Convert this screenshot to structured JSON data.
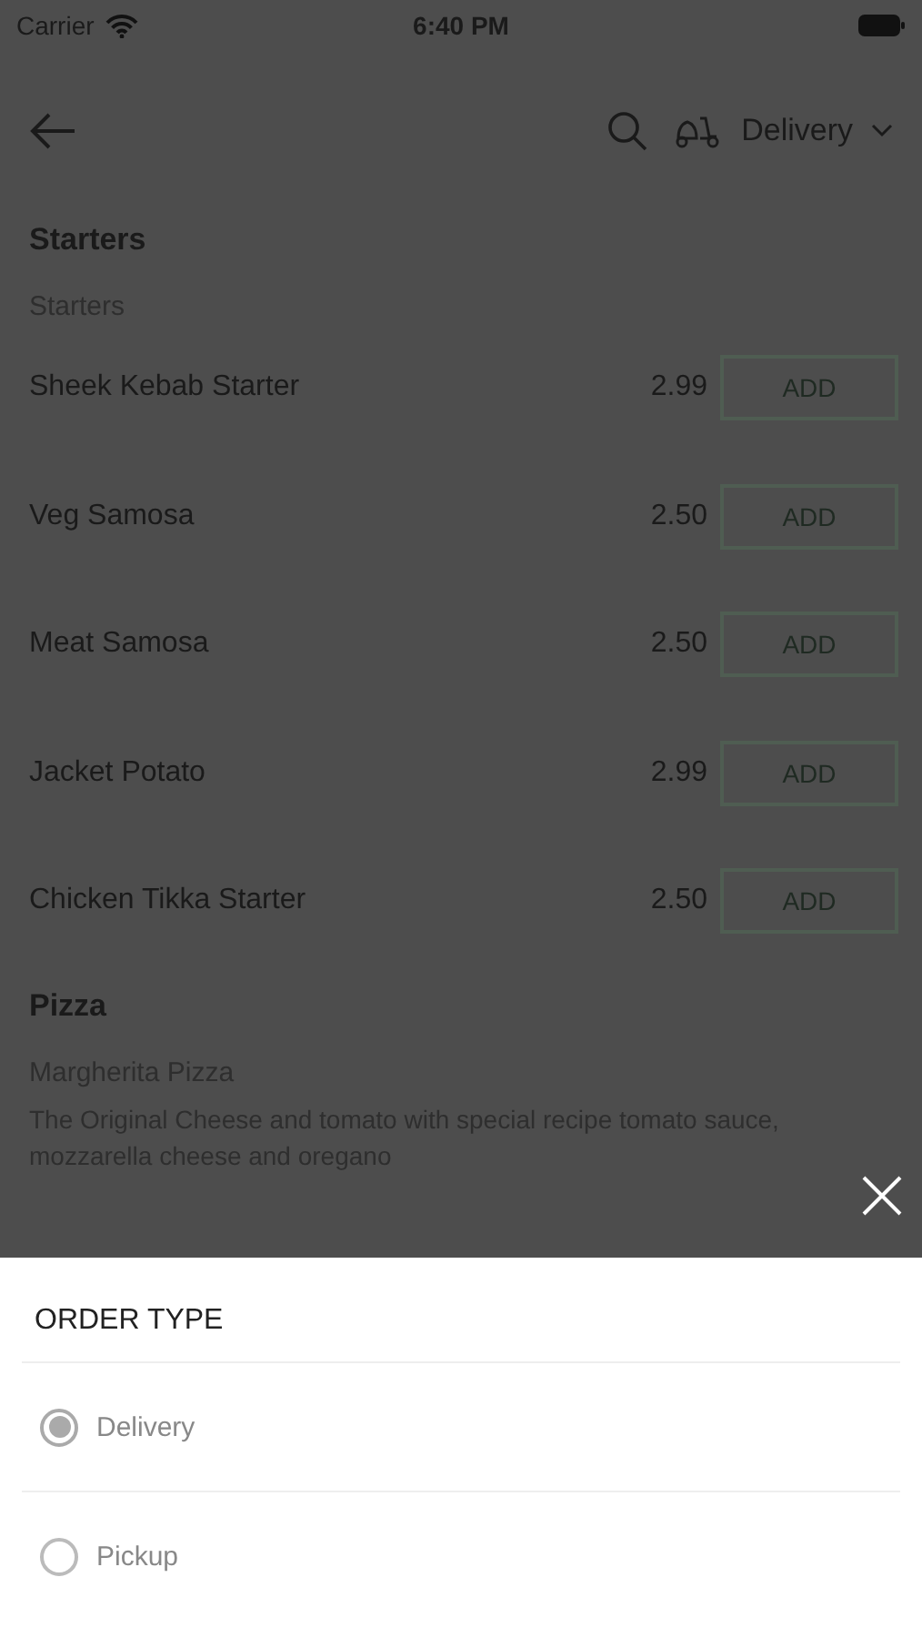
{
  "status_bar": {
    "carrier": "Carrier",
    "time": "6:40 PM"
  },
  "header": {
    "order_type": "Delivery"
  },
  "sections": [
    {
      "title": "Starters",
      "subtitle": "Starters",
      "items": [
        {
          "name": "Sheek Kebab Starter",
          "price": "2.99",
          "button": "ADD"
        },
        {
          "name": "Veg Samosa",
          "price": "2.50",
          "button": "ADD"
        },
        {
          "name": "Meat Samosa",
          "price": "2.50",
          "button": "ADD"
        },
        {
          "name": "Jacket Potato",
          "price": "2.99",
          "button": "ADD"
        },
        {
          "name": "Chicken Tikka Starter",
          "price": "2.50",
          "button": "ADD"
        }
      ]
    },
    {
      "title": "Pizza",
      "subtitle": "Margherita Pizza",
      "description": "The Original Cheese and tomato with special recipe tomato sauce, mozzarella cheese and oregano"
    }
  ],
  "sheet": {
    "title": "ORDER TYPE",
    "options": [
      {
        "label": "Delivery",
        "selected": true
      },
      {
        "label": "Pickup",
        "selected": false
      }
    ]
  }
}
